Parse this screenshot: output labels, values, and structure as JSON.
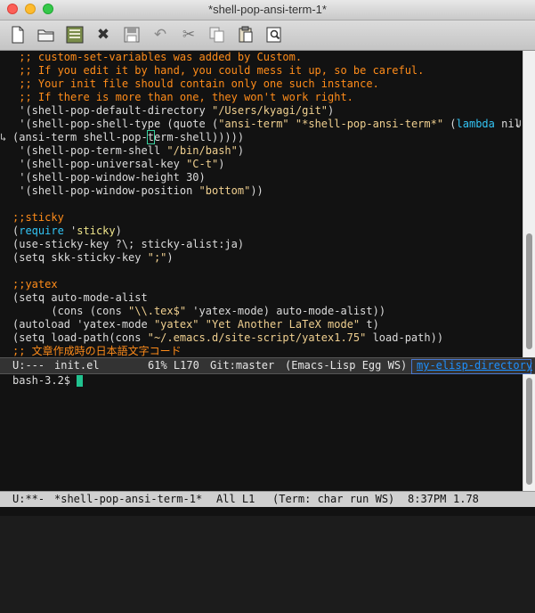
{
  "window": {
    "title": "*shell-pop-ansi-term-1*"
  },
  "toolbar": {
    "buttons": [
      {
        "name": "new-file",
        "icon": "new-file-icon"
      },
      {
        "name": "open-folder",
        "icon": "folder-icon"
      },
      {
        "name": "dired",
        "icon": "dired-icon"
      },
      {
        "name": "close",
        "icon": "close-icon",
        "glyph": "✖"
      },
      {
        "name": "save",
        "icon": "save-icon"
      },
      {
        "name": "undo",
        "icon": "undo-icon",
        "glyph": "↶"
      },
      {
        "name": "cut",
        "icon": "scissors-icon",
        "glyph": "✂"
      },
      {
        "name": "copy",
        "icon": "copy-icon"
      },
      {
        "name": "paste",
        "icon": "paste-icon"
      },
      {
        "name": "search",
        "icon": "search-icon"
      }
    ]
  },
  "editor": {
    "lines": [
      [
        {
          "t": " ;; custom-set-variables was added by Custom.",
          "c": "cm"
        }
      ],
      [
        {
          "t": " ;; If you edit it by hand, you could mess it up, so be careful.",
          "c": "cm"
        }
      ],
      [
        {
          "t": " ;; Your init file should contain only one such instance.",
          "c": "cm"
        }
      ],
      [
        {
          "t": " ;; If there is more than one, they won't work right.",
          "c": "cm"
        }
      ],
      [
        {
          "t": " '(shell-pop-default-directory "
        },
        {
          "t": "\"/Users/kyagi/git\"",
          "c": "st"
        },
        {
          "t": ")"
        }
      ],
      [
        {
          "t": " '(shell-pop-shell-type (quote ("
        },
        {
          "t": "\"ansi-term\"",
          "c": "st"
        },
        {
          "t": " "
        },
        {
          "t": "\"*shell-pop-ansi-term*\"",
          "c": "st"
        },
        {
          "t": " ("
        },
        {
          "t": "lambda",
          "c": "kw"
        },
        {
          "t": " nil"
        }
      ],
      [
        {
          "t": "(ansi-term shell-pop-"
        },
        {
          "t": "t",
          "c": "cursor"
        },
        {
          "t": "erm-shell)))))"
        }
      ],
      [
        {
          "t": " '(shell-pop-term-shell "
        },
        {
          "t": "\"/bin/bash\"",
          "c": "st"
        },
        {
          "t": ")"
        }
      ],
      [
        {
          "t": " '(shell-pop-universal-key "
        },
        {
          "t": "\"C-t\"",
          "c": "st"
        },
        {
          "t": ")"
        }
      ],
      [
        {
          "t": " '(shell-pop-window-height 30)"
        }
      ],
      [
        {
          "t": " '(shell-pop-window-position "
        },
        {
          "t": "\"bottom\"",
          "c": "st"
        },
        {
          "t": "))"
        }
      ],
      [
        {
          "t": ""
        }
      ],
      [
        {
          "t": ";;sticky",
          "c": "cm"
        }
      ],
      [
        {
          "t": "("
        },
        {
          "t": "require",
          "c": "kw"
        },
        {
          "t": " '"
        },
        {
          "t": "sticky",
          "c": "bi"
        },
        {
          "t": ")"
        }
      ],
      [
        {
          "t": "(use-sticky-key ?\\; sticky-alist:ja)"
        }
      ],
      [
        {
          "t": "(setq skk-sticky-key "
        },
        {
          "t": "\";\"",
          "c": "st"
        },
        {
          "t": ")"
        }
      ],
      [
        {
          "t": ""
        }
      ],
      [
        {
          "t": ";;yatex",
          "c": "cm"
        }
      ],
      [
        {
          "t": "(setq auto-mode-alist"
        }
      ],
      [
        {
          "t": "      (cons (cons "
        },
        {
          "t": "\"\\\\.tex$\"",
          "c": "st"
        },
        {
          "t": " 'yatex-mode) auto-mode-alist))"
        }
      ],
      [
        {
          "t": "(autoload 'yatex-mode "
        },
        {
          "t": "\"yatex\"",
          "c": "st"
        },
        {
          "t": " "
        },
        {
          "t": "\"Yet Another LaTeX mode\"",
          "c": "st"
        },
        {
          "t": " t)"
        }
      ],
      [
        {
          "t": "(setq load-path(cons "
        },
        {
          "t": "\"~/.emacs.d/site-script/yatex1.75\"",
          "c": "st"
        },
        {
          "t": " load-path))"
        }
      ],
      [
        {
          "t": ";; 文章作成時の日本語文字コード",
          "c": "cm"
        }
      ]
    ]
  },
  "modeline_top": {
    "status": "U:---",
    "buffer": "init.el",
    "position": "61% L170",
    "vc": "Git:master",
    "modes": "(Emacs-Lisp Egg WS)",
    "directory": "my-elisp-directory"
  },
  "terminal": {
    "prompt": "bash-3.2$ "
  },
  "modeline_bottom": {
    "status": "U:**-",
    "buffer": "*shell-pop-ansi-term-1*",
    "position": "All L1",
    "modes": "(Term: char run WS)",
    "time": "8:37PM",
    "load": "1.78"
  }
}
